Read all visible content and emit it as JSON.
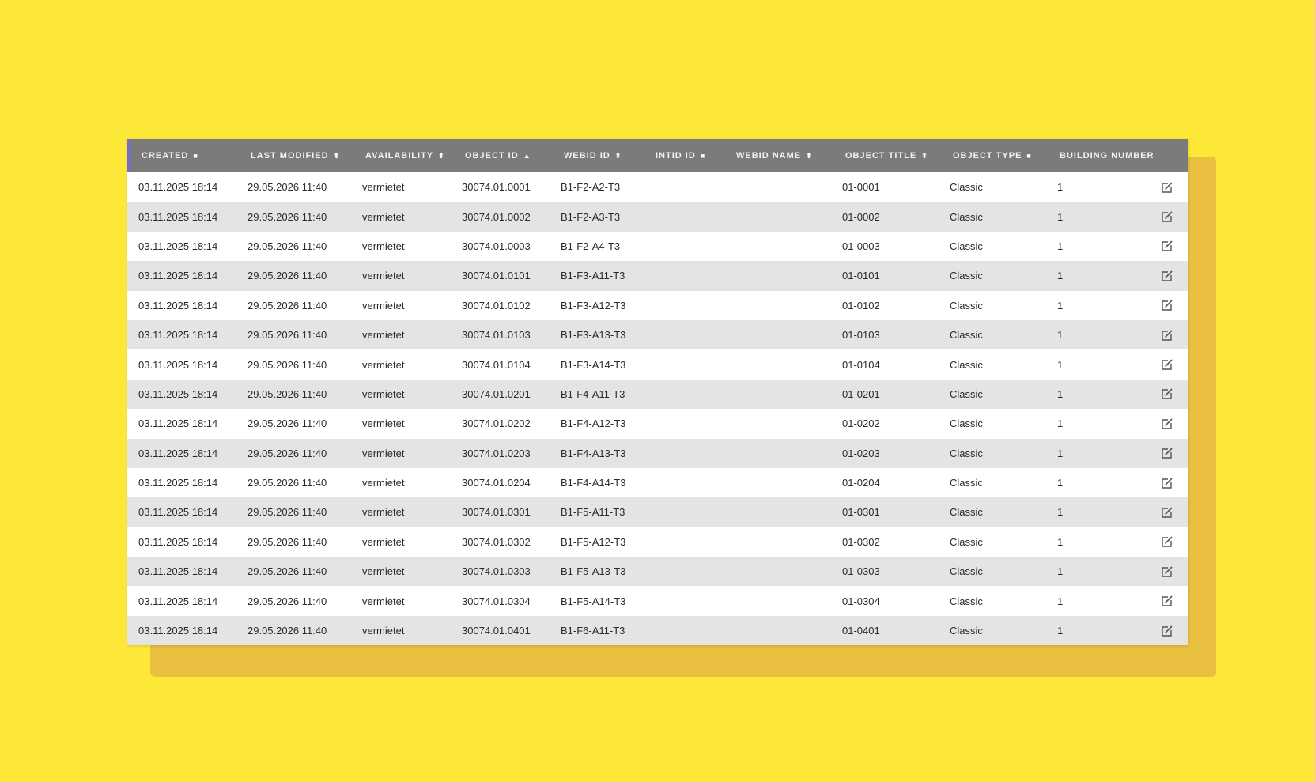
{
  "table": {
    "columns": [
      {
        "label": "Created",
        "sort_icon": "■"
      },
      {
        "label": "Last modified",
        "sort_icon": "⬍"
      },
      {
        "label": "Availability",
        "sort_icon": "⬍"
      },
      {
        "label": "Object ID",
        "sort_icon": "▲"
      },
      {
        "label": "Webid ID",
        "sort_icon": "⬍"
      },
      {
        "label": "Intid ID",
        "sort_icon": "■"
      },
      {
        "label": "Webid name",
        "sort_icon": "⬍"
      },
      {
        "label": "Object title",
        "sort_icon": "⬍"
      },
      {
        "label": "Object type",
        "sort_icon": "■"
      },
      {
        "label": "Building number",
        "sort_icon": ""
      }
    ],
    "rows": [
      {
        "created": "03.11.2025 18:14",
        "modified": "29.05.2026 11:40",
        "availability": "vermietet",
        "object_id": "30074.01.0001",
        "webid_id": "B1-F2-A2-T3",
        "intid_id": "",
        "webid_name": "",
        "object_title": "01-0001",
        "object_type": "Classic",
        "building": "1"
      },
      {
        "created": "03.11.2025 18:14",
        "modified": "29.05.2026 11:40",
        "availability": "vermietet",
        "object_id": "30074.01.0002",
        "webid_id": "B1-F2-A3-T3",
        "intid_id": "",
        "webid_name": "",
        "object_title": "01-0002",
        "object_type": "Classic",
        "building": "1"
      },
      {
        "created": "03.11.2025 18:14",
        "modified": "29.05.2026 11:40",
        "availability": "vermietet",
        "object_id": "30074.01.0003",
        "webid_id": "B1-F2-A4-T3",
        "intid_id": "",
        "webid_name": "",
        "object_title": "01-0003",
        "object_type": "Classic",
        "building": "1"
      },
      {
        "created": "03.11.2025 18:14",
        "modified": "29.05.2026 11:40",
        "availability": "vermietet",
        "object_id": "30074.01.0101",
        "webid_id": "B1-F3-A11-T3",
        "intid_id": "",
        "webid_name": "",
        "object_title": "01-0101",
        "object_type": "Classic",
        "building": "1"
      },
      {
        "created": "03.11.2025 18:14",
        "modified": "29.05.2026 11:40",
        "availability": "vermietet",
        "object_id": "30074.01.0102",
        "webid_id": "B1-F3-A12-T3",
        "intid_id": "",
        "webid_name": "",
        "object_title": "01-0102",
        "object_type": "Classic",
        "building": "1"
      },
      {
        "created": "03.11.2025 18:14",
        "modified": "29.05.2026 11:40",
        "availability": "vermietet",
        "object_id": "30074.01.0103",
        "webid_id": "B1-F3-A13-T3",
        "intid_id": "",
        "webid_name": "",
        "object_title": "01-0103",
        "object_type": "Classic",
        "building": "1"
      },
      {
        "created": "03.11.2025 18:14",
        "modified": "29.05.2026 11:40",
        "availability": "vermietet",
        "object_id": "30074.01.0104",
        "webid_id": "B1-F3-A14-T3",
        "intid_id": "",
        "webid_name": "",
        "object_title": "01-0104",
        "object_type": "Classic",
        "building": "1"
      },
      {
        "created": "03.11.2025 18:14",
        "modified": "29.05.2026 11:40",
        "availability": "vermietet",
        "object_id": "30074.01.0201",
        "webid_id": "B1-F4-A11-T3",
        "intid_id": "",
        "webid_name": "",
        "object_title": "01-0201",
        "object_type": "Classic",
        "building": "1"
      },
      {
        "created": "03.11.2025 18:14",
        "modified": "29.05.2026 11:40",
        "availability": "vermietet",
        "object_id": "30074.01.0202",
        "webid_id": "B1-F4-A12-T3",
        "intid_id": "",
        "webid_name": "",
        "object_title": "01-0202",
        "object_type": "Classic",
        "building": "1"
      },
      {
        "created": "03.11.2025 18:14",
        "modified": "29.05.2026 11:40",
        "availability": "vermietet",
        "object_id": "30074.01.0203",
        "webid_id": "B1-F4-A13-T3",
        "intid_id": "",
        "webid_name": "",
        "object_title": "01-0203",
        "object_type": "Classic",
        "building": "1"
      },
      {
        "created": "03.11.2025 18:14",
        "modified": "29.05.2026 11:40",
        "availability": "vermietet",
        "object_id": "30074.01.0204",
        "webid_id": "B1-F4-A14-T3",
        "intid_id": "",
        "webid_name": "",
        "object_title": "01-0204",
        "object_type": "Classic",
        "building": "1"
      },
      {
        "created": "03.11.2025 18:14",
        "modified": "29.05.2026 11:40",
        "availability": "vermietet",
        "object_id": "30074.01.0301",
        "webid_id": "B1-F5-A11-T3",
        "intid_id": "",
        "webid_name": "",
        "object_title": "01-0301",
        "object_type": "Classic",
        "building": "1"
      },
      {
        "created": "03.11.2025 18:14",
        "modified": "29.05.2026 11:40",
        "availability": "vermietet",
        "object_id": "30074.01.0302",
        "webid_id": "B1-F5-A12-T3",
        "intid_id": "",
        "webid_name": "",
        "object_title": "01-0302",
        "object_type": "Classic",
        "building": "1"
      },
      {
        "created": "03.11.2025 18:14",
        "modified": "29.05.2026 11:40",
        "availability": "vermietet",
        "object_id": "30074.01.0303",
        "webid_id": "B1-F5-A13-T3",
        "intid_id": "",
        "webid_name": "",
        "object_title": "01-0303",
        "object_type": "Classic",
        "building": "1"
      },
      {
        "created": "03.11.2025 18:14",
        "modified": "29.05.2026 11:40",
        "availability": "vermietet",
        "object_id": "30074.01.0304",
        "webid_id": "B1-F5-A14-T3",
        "intid_id": "",
        "webid_name": "",
        "object_title": "01-0304",
        "object_type": "Classic",
        "building": "1"
      },
      {
        "created": "03.11.2025 18:14",
        "modified": "29.05.2026 11:40",
        "availability": "vermietet",
        "object_id": "30074.01.0401",
        "webid_id": "B1-F6-A11-T3",
        "intid_id": "",
        "webid_name": "",
        "object_title": "01-0401",
        "object_type": "Classic",
        "building": "1"
      }
    ],
    "row_action_icon": "edit-icon"
  },
  "colors": {
    "background": "#fde838",
    "header": "#7b7b7b",
    "header_accent": "#6f6fd0",
    "row_alt": "#e4e4e4"
  }
}
